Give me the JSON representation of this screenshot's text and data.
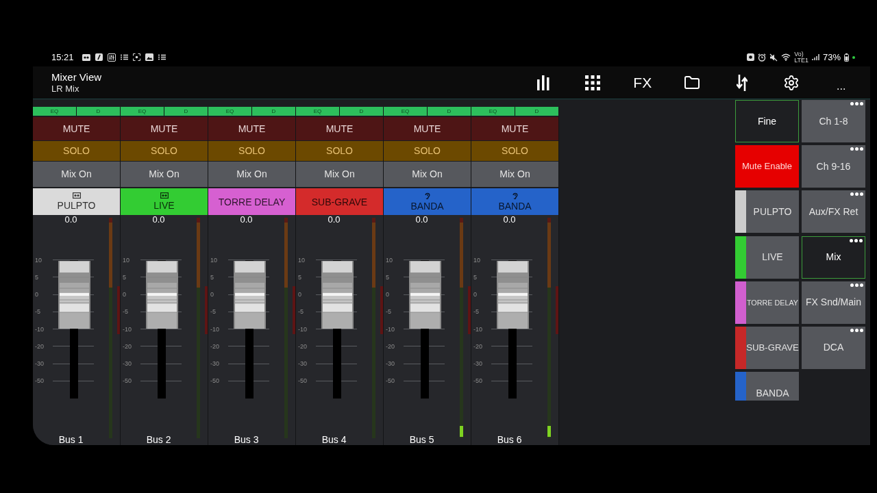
{
  "status_bar": {
    "time": "15:21",
    "network": [
      "Vo)",
      "LTE1"
    ],
    "battery": "73%"
  },
  "header": {
    "title": "Mixer View",
    "subtitle": "LR Mix",
    "fx": "FX",
    "more": "..."
  },
  "strips": [
    {
      "indicators": [
        {
          "label": "EQ",
          "on": true
        },
        {
          "label": "D",
          "on": true
        }
      ],
      "mute": {
        "label": "MUTE",
        "on": false
      },
      "solo": {
        "label": "SOLO",
        "on": false
      },
      "mix": "Mix On",
      "name": "PULPTO",
      "color": "#dadada",
      "kind": "speaker",
      "reading": "0.0",
      "scale": [
        "10",
        "5",
        "0",
        "-5",
        "-10",
        "-20",
        "-30",
        "-50"
      ],
      "fader": {
        "level": 0.75
      },
      "meter": {
        "level": 0
      },
      "label": "Bus 1"
    },
    {
      "indicators": [
        {
          "label": "EQ",
          "on": true
        },
        {
          "label": "D",
          "on": true
        }
      ],
      "mute": {
        "label": "MUTE",
        "on": false
      },
      "solo": {
        "label": "SOLO",
        "on": false
      },
      "mix": "Mix On",
      "name": "LIVE",
      "color": "#33cc33",
      "kind": "speaker",
      "reading": "0.0",
      "scale": [
        "10",
        "5",
        "0",
        "-5",
        "-10",
        "-20",
        "-30",
        "-50"
      ],
      "fader": {
        "level": 0.75
      },
      "meter": {
        "level": 0
      },
      "label": "Bus 2"
    },
    {
      "indicators": [
        {
          "label": "EQ",
          "on": true
        },
        {
          "label": "D",
          "on": true
        }
      ],
      "mute": {
        "label": "MUTE",
        "on": false
      },
      "solo": {
        "label": "SOLO",
        "on": false
      },
      "mix": "Mix On",
      "name": "TORRE DELAY",
      "color": "#d660d1",
      "kind": "plain",
      "reading": "0.0",
      "scale": [
        "10",
        "5",
        "0",
        "-5",
        "-10",
        "-20",
        "-30",
        "-50"
      ],
      "fader": {
        "level": 0.75
      },
      "meter": {
        "level": 0
      },
      "label": "Bus 3"
    },
    {
      "indicators": [
        {
          "label": "EQ",
          "on": true
        },
        {
          "label": "D",
          "on": true
        }
      ],
      "mute": {
        "label": "MUTE",
        "on": false
      },
      "solo": {
        "label": "SOLO",
        "on": false
      },
      "mix": "Mix On",
      "name": "SUB-GRAVE",
      "color": "#d42b2b",
      "kind": "plain",
      "reading": "0.0",
      "scale": [
        "10",
        "5",
        "0",
        "-5",
        "-10",
        "-20",
        "-30",
        "-50"
      ],
      "fader": {
        "level": 0.75
      },
      "meter": {
        "level": 0
      },
      "label": "Bus 4"
    },
    {
      "indicators": [
        {
          "label": "EQ",
          "on": true
        },
        {
          "label": "D",
          "on": true
        }
      ],
      "mute": {
        "label": "MUTE",
        "on": false
      },
      "solo": {
        "label": "SOLO",
        "on": false
      },
      "mix": "Mix On",
      "name": "BANDA",
      "color": "#2563c9",
      "kind": "ear",
      "reading": "0.0",
      "scale": [
        "10",
        "5",
        "0",
        "-5",
        "-10",
        "-20",
        "-30",
        "-50"
      ],
      "fader": {
        "level": 0.75
      },
      "meter": {
        "level": 0.05
      },
      "label": "Bus 5"
    },
    {
      "indicators": [
        {
          "label": "EQ",
          "on": true
        },
        {
          "label": "D",
          "on": true
        }
      ],
      "mute": {
        "label": "MUTE",
        "on": false
      },
      "solo": {
        "label": "SOLO",
        "on": false
      },
      "mix": "Mix On",
      "name": "BANDA",
      "color": "#2563c9",
      "kind": "ear",
      "reading": "0.0",
      "scale": [
        "10",
        "5",
        "0",
        "-5",
        "-10",
        "-20",
        "-30",
        "-50"
      ],
      "fader": {
        "level": 0.75
      },
      "meter": {
        "level": 0.05
      },
      "label": "Bus 6"
    }
  ],
  "panel": {
    "left": [
      {
        "label": "Fine",
        "kind": "toggle",
        "on": true
      },
      {
        "label": "Mute Enable",
        "kind": "alert",
        "color": "#e60000"
      },
      {
        "label": "PULPTO",
        "kind": "group",
        "color": "#cccccc"
      },
      {
        "label": "LIVE",
        "kind": "group",
        "color": "#33cc33"
      },
      {
        "label": "TORRE DELAY",
        "kind": "group",
        "color": "#d15fcf"
      },
      {
        "label": "SUB-GRAVE",
        "kind": "group",
        "color": "#c62828"
      },
      {
        "label": "BANDA",
        "kind": "group",
        "color": "#2563c9"
      }
    ],
    "right": [
      {
        "label": "Ch 1-8",
        "selected": false
      },
      {
        "label": "Ch 9-16",
        "selected": false
      },
      {
        "label": "Aux/FX Ret",
        "selected": false
      },
      {
        "label": "Mix",
        "selected": true
      },
      {
        "label": "FX Snd/Main",
        "selected": false
      },
      {
        "label": "DCA",
        "selected": false
      }
    ]
  }
}
